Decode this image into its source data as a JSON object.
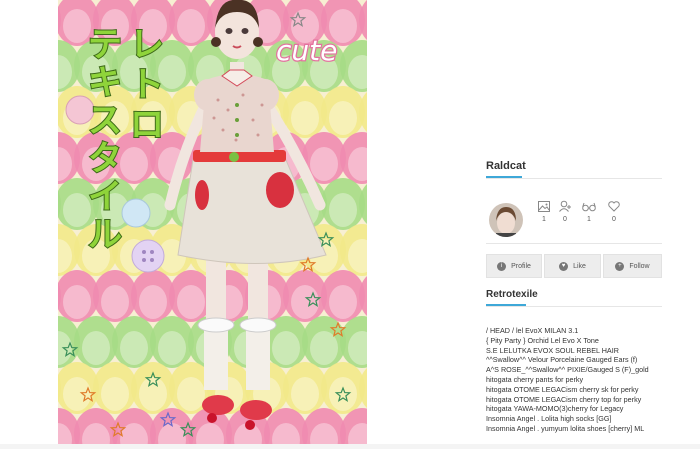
{
  "photo": {
    "vertical_title": "レトロテキスタイル",
    "sticker_text": "cute",
    "colors": {
      "scallop_pink": "#f08bb0",
      "scallop_green": "#a6dc86",
      "scallop_yellow": "#f2e98a",
      "scallop_cream": "#f7efd2"
    }
  },
  "profile": {
    "username": "Raldcat",
    "stats": [
      {
        "icon": "image-icon",
        "value": "1"
      },
      {
        "icon": "user-add-icon",
        "value": "0"
      },
      {
        "icon": "glasses-icon",
        "value": "1"
      },
      {
        "icon": "heart-icon",
        "value": "0"
      }
    ],
    "buttons": [
      {
        "label": "Profile",
        "icon": "info-icon"
      },
      {
        "label": "Like",
        "icon": "heart-icon"
      },
      {
        "label": "Follow",
        "icon": "plus-icon"
      }
    ]
  },
  "post": {
    "title": "Retrotexile",
    "credits": [
      "/ HEAD / lel EvoX MILAN 3.1",
      "{ Pity Party } Orchid Lel Evo X Tone",
      "S.E LELUTKA EVOX SOUL REBEL HAIR",
      "^^Swallow^^ Velour Porcelaine Gauged Ears (f)",
      "A^S ROSE_^^Swallow^^ PIXIE/Gauged S (F)_gold",
      "hitogata cherry pants for perky",
      "hitogata OTOME LEGACism cherry sk for perky",
      "hitogata OTOME LEGACism cherry top for perky",
      "hitogata YAWA-MOMO(3)cherry for Legacy",
      "Insomnia Angel . Lolita high socks [GG]",
      "Insomnia Angel . yumyum lolita shoes [cherry] ML"
    ]
  },
  "accent": "#3ea8d8"
}
